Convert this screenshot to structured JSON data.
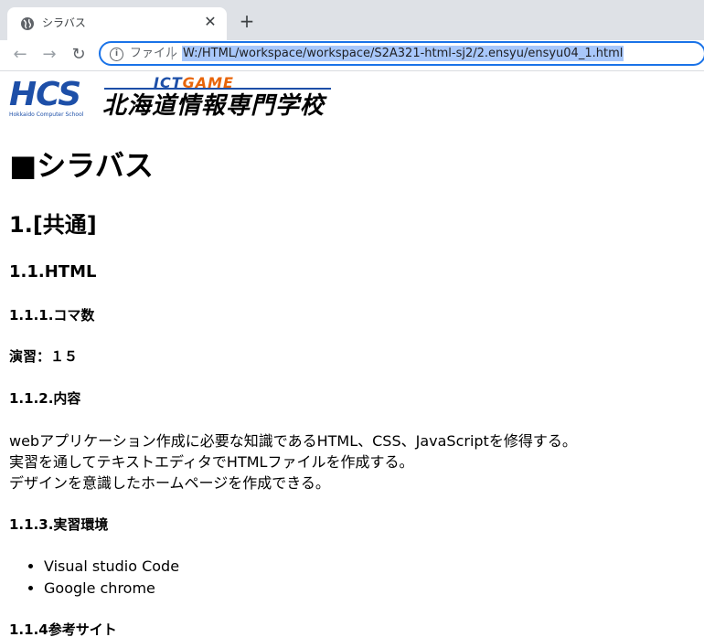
{
  "browser": {
    "tab_title": "シラバス",
    "tab_close": "✕",
    "new_tab": "+",
    "omnibox_label": "ファイル",
    "omnibox_sep": "|",
    "url": "W:/HTML/workspace/workspace/S2A321-html-sj2/2.ensyu/ensyu04_1.html"
  },
  "logos": {
    "hcs": "HCS",
    "hcs_sub": "Hokkaido Computer School",
    "ict": "ICT",
    "game": "GAME",
    "school_name": "北海道情報専門学校"
  },
  "page": {
    "title": "■シラバス",
    "section1": "1.[共通]",
    "subsection": "1.1.HTML",
    "koma_heading": "1.1.1.コマ数",
    "koma_value": "演習：１５",
    "naiyou_heading": "1.1.2.内容",
    "naiyou_lines": [
      "webアプリケーション作成に必要な知識であるHTML、CSS、JavaScriptを修得する。",
      "実習を通してテキストエディタでHTMLファイルを作成する。",
      "デザインを意識したホームページを作成できる。"
    ],
    "env_heading": "1.1.3.実習環境",
    "env_items": [
      "Visual studio Code",
      "Google chrome"
    ],
    "ref_heading": "1.1.4参考サイト"
  }
}
